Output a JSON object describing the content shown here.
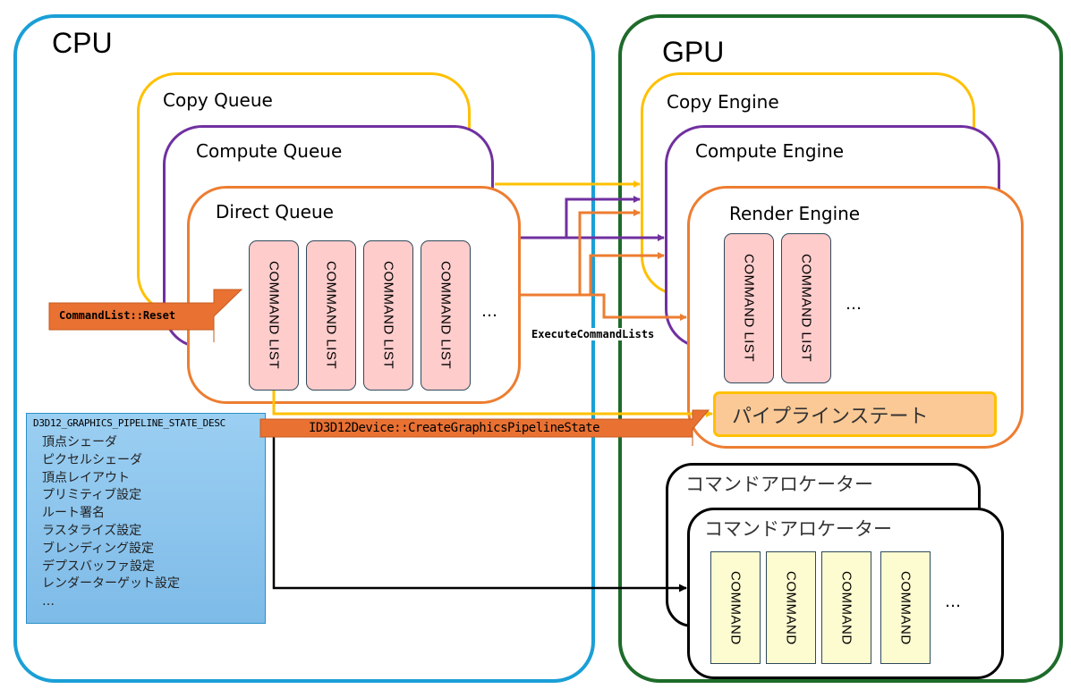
{
  "cpu": {
    "label": "CPU",
    "queues": {
      "copy": "Copy Queue",
      "compute": "Compute Queue",
      "direct": "Direct Queue"
    },
    "command_lists": [
      "COMMAND LIST",
      "COMMAND LIST",
      "COMMAND LIST",
      "COMMAND LIST"
    ],
    "command_lists_more": "…",
    "reset_arrow_label": "CommandList::Reset",
    "pso_desc": {
      "title": "D3D12_GRAPHICS_PIPELINE_STATE_DESC",
      "items": [
        "頂点シェーダ",
        "ピクセルシェーダ",
        "頂点レイアウト",
        "プリミティブ設定",
        "ルート署名",
        "ラスタライズ設定",
        "ブレンディング設定",
        "デプスバッファ設定",
        "レンダーターゲット設定",
        "…"
      ]
    }
  },
  "gpu": {
    "label": "GPU",
    "engines": {
      "copy": "Copy Engine",
      "compute": "Compute Engine",
      "render": "Render Engine"
    },
    "command_lists": [
      "COMMAND LIST",
      "COMMAND LIST"
    ],
    "command_lists_more": "…",
    "pipeline_state": "パイプラインステート",
    "allocators": [
      "コマンドアロケーター",
      "コマンドアロケーター"
    ],
    "commands": [
      "COMMAND",
      "COMMAND",
      "COMMAND",
      "COMMAND"
    ],
    "commands_more": "…"
  },
  "execute_label": "ExecuteCommandLists",
  "create_pso_label": "ID3D12Device::CreateGraphicsPipelineState",
  "colors": {
    "cpu": "#1a9fd6",
    "gpu": "#1e6b2a",
    "copy": "#ffc000",
    "compute": "#7030a0",
    "direct": "#ed7d31",
    "arrow_fill": "#e97132",
    "pso_desc_bg": "#8ec8f0",
    "pipeline_state_bg": "#fbc996"
  }
}
